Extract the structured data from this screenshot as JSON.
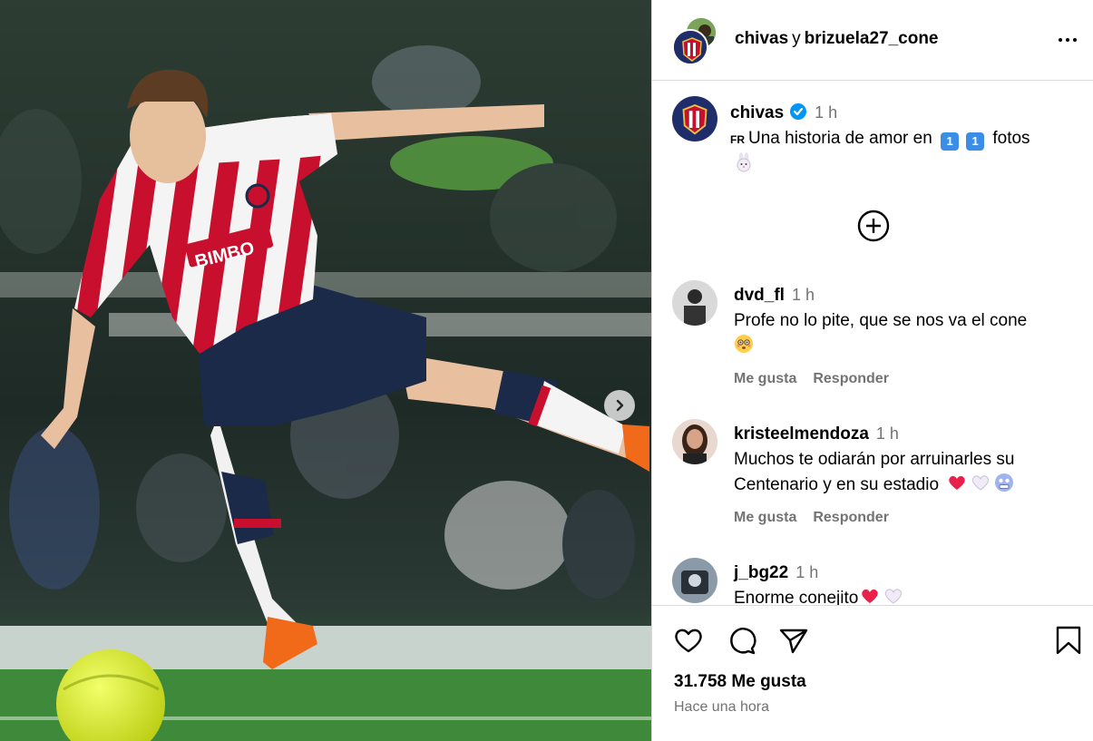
{
  "header": {
    "user1": "chivas",
    "connector": "y",
    "user2": "brizuela27_cone"
  },
  "caption": {
    "username": "chivas",
    "time": "1 h",
    "lang_tag": "FR",
    "text_a": "Una historia de amor en",
    "num_1": "1",
    "num_2": "1",
    "text_b": "fotos",
    "emoji_icon": "rabbit-face-icon"
  },
  "comments": [
    {
      "username": "dvd_fl",
      "time": "1 h",
      "text": "Profe no lo pite, que se nos va el cone",
      "like": "Me gusta",
      "reply": "Responder"
    },
    {
      "username": "kristeelmendoza",
      "time": "1 h",
      "text": "Muchos te odiarán por arruinarles su Centenario y en su estadio",
      "like": "Me gusta",
      "reply": "Responder"
    },
    {
      "username": "j_bg22",
      "time": "1 h",
      "text": "Enorme conejito"
    }
  ],
  "footer": {
    "likes": "31.758 Me gusta",
    "posted": "Hace una hora"
  },
  "colors": {
    "jersey_red": "#c8102e",
    "shorts_navy": "#1c2a4a",
    "pitch_green": "#3f8a3a",
    "verified_blue": "#0095f6",
    "muted_text": "#737373"
  }
}
